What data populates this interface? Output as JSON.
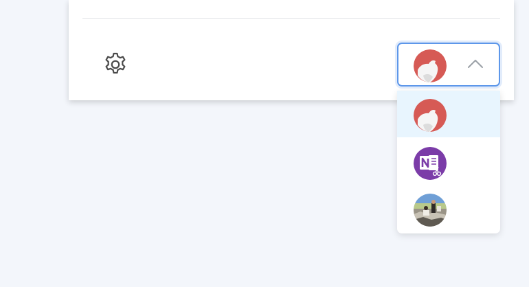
{
  "settings": {
    "icon": "gear-icon"
  },
  "account_selector": {
    "selected_account_icon": "bear-logo-icon",
    "toggle_icon": "chevron-up-icon",
    "expanded": true
  },
  "dropdown": {
    "options": [
      {
        "icon": "bear-logo-icon",
        "selected": true
      },
      {
        "icon": "onenote-clipper-icon",
        "selected": false
      },
      {
        "icon": "user-photo-avatar",
        "selected": false
      }
    ]
  },
  "colors": {
    "page_background": "#f3f6fb",
    "focus_border": "#5d97ea",
    "selected_row": "#e8f5fe",
    "bear_red": "#d65a55",
    "onenote_purple": "#7b3ca8"
  }
}
